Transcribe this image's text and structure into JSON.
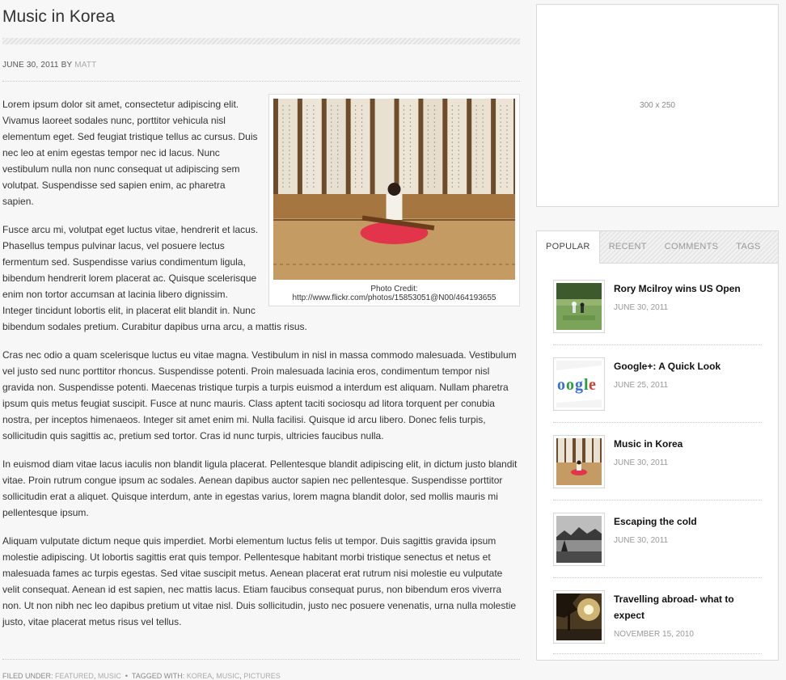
{
  "post": {
    "title": "Music in Korea",
    "date": "JUNE 30, 2011",
    "by": "BY",
    "author": "MATT",
    "figure_caption": "Photo Credit: http://www.flickr.com/photos/15853051@N00/464193655",
    "paragraphs": [
      "Lorem ipsum dolor sit amet, consectetur adipiscing elit. Vivamus laoreet sodales nunc, porttitor vehicula nisl elementum eget. Sed feugiat tristique tellus ac cursus. Duis nec leo at enim egestas tempor nec id lacus. Nunc vestibulum nulla non nunc consequat ut adipiscing sem volutpat. Suspendisse sed sapien enim, ac pharetra sapien.",
      "Fusce arcu mi, volutpat eget luctus vitae, hendrerit et lacus. Phasellus tempus pulvinar lacus, vel posuere lectus fermentum sed. Suspendisse varius condimentum ligula, bibendum hendrerit lorem placerat ac. Quisque scelerisque enim non tortor accumsan at lacinia libero dignissim. Integer tincidunt lobortis elit, in placerat elit blandit in. Nunc bibendum sodales pretium. Curabitur dapibus urna arcu, a mattis risus.",
      "Cras nec odio a quam scelerisque luctus eu vitae magna. Vestibulum in nisl in massa commodo malesuada. Vestibulum vel justo sed nunc porttitor rhoncus. Suspendisse potenti. Proin malesuada lacinia eros, condimentum tempor nisl gravida non. Suspendisse potenti. Maecenas tristique turpis a turpis euismod a interdum est aliquam. Nullam pharetra ipsum quis metus feugiat suscipit. Fusce at nunc mauris. Class aptent taciti sociosqu ad litora torquent per conubia nostra, per inceptos himenaeos. Integer sit amet enim mi. Nulla facilisi. Quisque id arcu libero. Donec felis turpis, sollicitudin quis sagittis ac, pretium sed tortor. Cras id nunc turpis, ultricies faucibus nulla.",
      "In euismod diam vitae lacus iaculis non blandit ligula placerat. Pellentesque blandit adipiscing elit, in dictum justo blandit vitae. Proin rutrum congue ipsum ac sodales. Aenean dapibus auctor sapien nec pellentesque. Suspendisse porttitor sollicitudin erat a aliquet. Quisque interdum, ante in egestas varius, lorem magna blandit dolor, sed mollis mauris mi pellentesque ipsum.",
      "Aliquam vulputate dictum neque quis imperdiet. Morbi elementum luctus felis ut tempor. Duis sagittis gravida ipsum molestie adipiscing. Ut lobortis sagittis erat quis tempor. Pellentesque habitant morbi tristique senectus et netus et malesuada fames ac turpis egestas. Sed vitae suscipit metus. Aenean placerat erat rutrum nisi molestie eu vulputate velit consequat. Aenean id est sapien, nec mattis lacus. Etiam faucibus consequat purus, non bibendum eros viverra non. Ut non nibh nec leo dapibus pretium ut vitae nisl. Duis sollicitudin, justo nec posuere venenatis, urna nulla molestie justo, vitae placerat metus risus vel tellus."
    ],
    "footer": {
      "filed_under": "FILED UNDER:",
      "categories": [
        "FEATURED",
        "MUSIC"
      ],
      "tagged_with": "TAGGED WITH:",
      "tags": [
        "KOREA",
        "MUSIC",
        "PICTURES"
      ]
    }
  },
  "sidebar": {
    "ad_label": "300 x 250",
    "tabs": [
      "POPULAR",
      "RECENT",
      "COMMENTS",
      "TAGS"
    ],
    "active_tab": "POPULAR",
    "items": [
      {
        "title": "Rory Mcilroy wins US Open",
        "date": "JUNE 30, 2011",
        "thumb": "golf"
      },
      {
        "title": "Google+: A Quick Look",
        "date": "JUNE 25, 2011",
        "thumb": "google-logo"
      },
      {
        "title": "Music in Korea",
        "date": "JUNE 30, 2011",
        "thumb": "korea-music"
      },
      {
        "title": "Escaping the cold",
        "date": "JUNE 30, 2011",
        "thumb": "lake-landscape"
      },
      {
        "title": "Travelling abroad- what to expect",
        "date": "NOVEMBER 15, 2010",
        "thumb": "sunset-tree"
      }
    ]
  }
}
